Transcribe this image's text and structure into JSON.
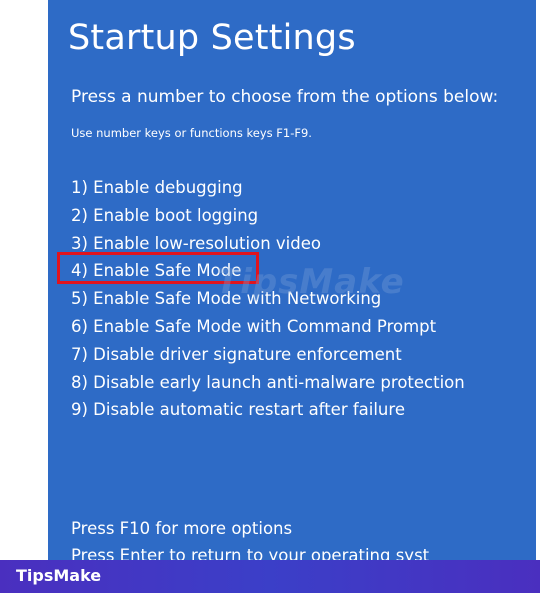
{
  "screen": {
    "title": "Startup Settings",
    "subtitle": "Press a number to choose from the options below:",
    "hint": "Use number keys or functions keys F1-F9.",
    "options": [
      "1) Enable debugging",
      "2) Enable boot logging",
      "3) Enable low-resolution video",
      "4) Enable Safe Mode",
      "5) Enable Safe Mode with Networking",
      "6) Enable Safe Mode with Command Prompt",
      "7) Disable driver signature enforcement",
      "8) Disable early launch anti-malware protection",
      "9) Disable automatic restart after failure"
    ],
    "highlighted_option_index": 3,
    "footer_more": "Press F10 for more options",
    "footer_return": "Press Enter to return to your operating syst",
    "background_color": "#2e6bc6",
    "highlight_color": "#e0141e"
  },
  "overlay": {
    "watermark": "TipsMake",
    "corner_logo": "TipsMake"
  }
}
